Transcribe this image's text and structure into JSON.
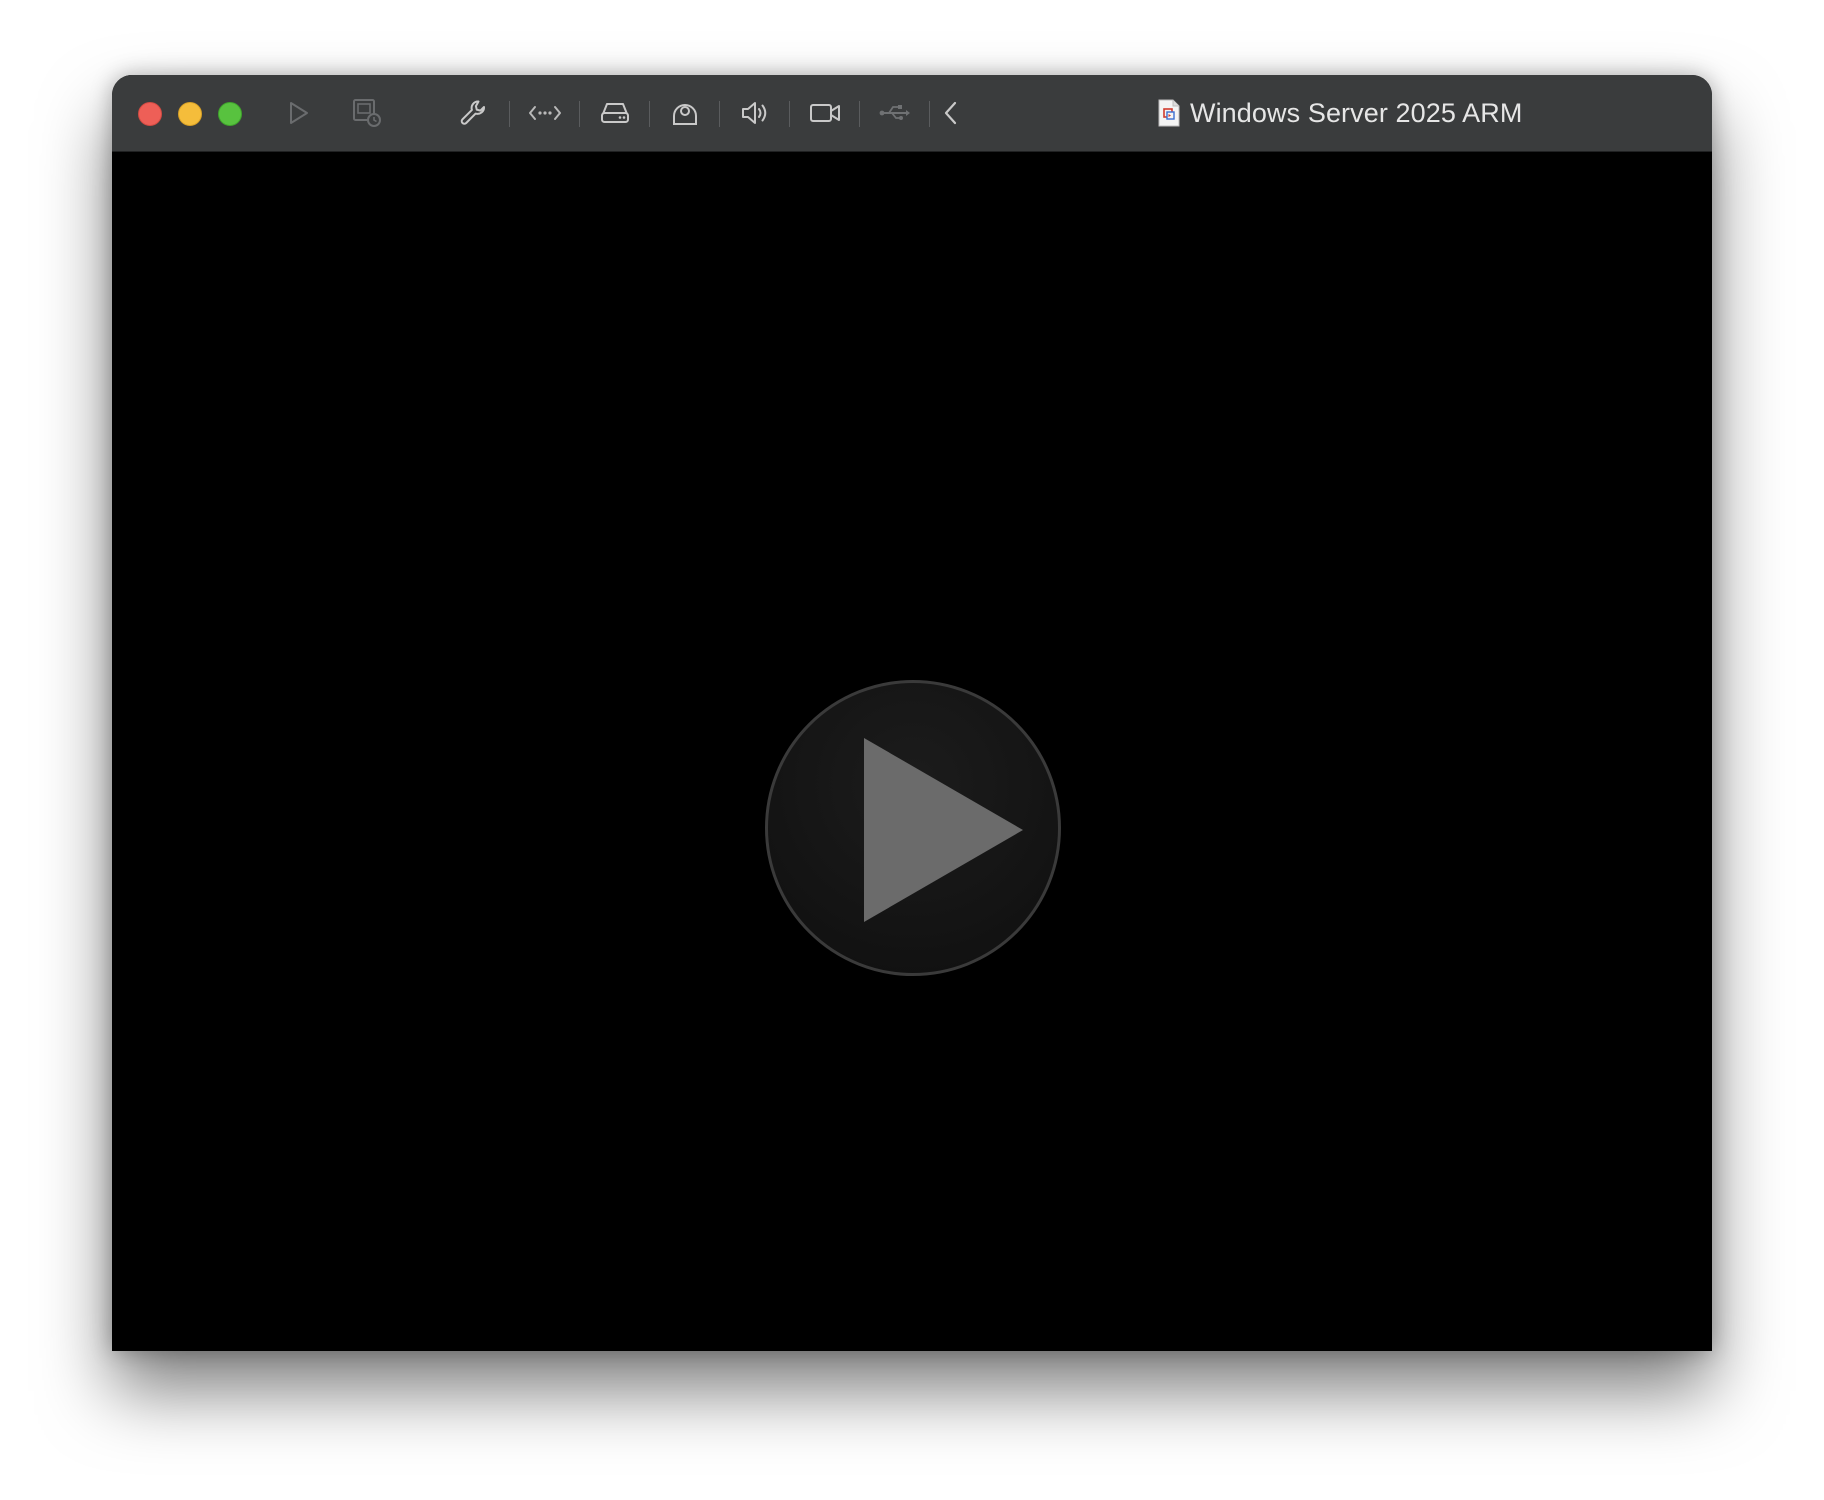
{
  "window": {
    "title": "Windows Server 2025 ARM"
  },
  "traffic_lights": {
    "close_color": "#ee5f57",
    "minimize_color": "#f5bd3b",
    "zoom_color": "#58c23f"
  },
  "toolbar": {
    "items": [
      {
        "name": "play",
        "icon": "play-icon"
      },
      {
        "name": "snapshots",
        "icon": "snapshot-icon"
      },
      {
        "name": "settings",
        "icon": "wrench-icon"
      },
      {
        "name": "network",
        "icon": "network-icon"
      },
      {
        "name": "hard-disk",
        "icon": "hard-disk-icon"
      },
      {
        "name": "optical-drive",
        "icon": "optical-drive-icon"
      },
      {
        "name": "sound",
        "icon": "speaker-icon"
      },
      {
        "name": "camera",
        "icon": "camera-icon"
      },
      {
        "name": "usb",
        "icon": "usb-icon"
      },
      {
        "name": "collapse",
        "icon": "chevron-left-icon"
      }
    ]
  },
  "screen": {
    "background": "#000000",
    "center_button_icon": "play-icon"
  }
}
